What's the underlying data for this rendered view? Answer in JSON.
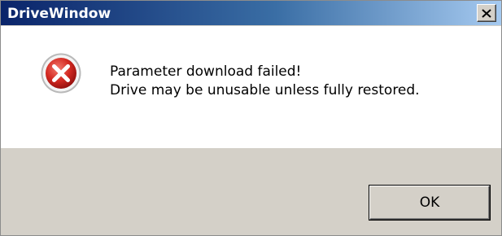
{
  "window": {
    "title": "DriveWindow"
  },
  "message": {
    "line1": "Parameter download failed!",
    "line2": "Drive may be unusable unless fully restored."
  },
  "buttons": {
    "ok_label": "OK"
  },
  "icons": {
    "close": "close-icon",
    "error": "error-icon"
  },
  "colors": {
    "titlebar_start": "#0a246a",
    "titlebar_end": "#a6caf0",
    "error_red": "#c8211d",
    "dialog_face": "#d4d0c8"
  }
}
